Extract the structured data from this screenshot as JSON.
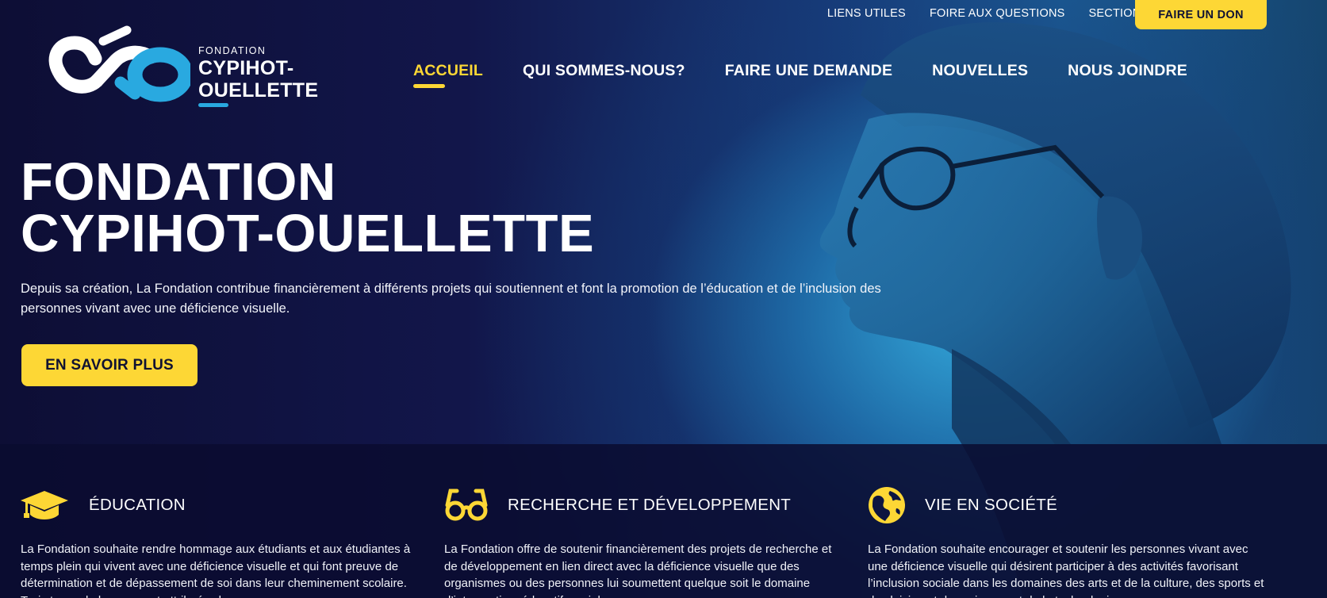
{
  "topnav": {
    "links": [
      "LIENS UTILES",
      "FOIRE AUX QUESTIONS",
      "SECTION PRIVÉE"
    ],
    "donate_label": "FAIRE UN DON"
  },
  "logo": {
    "small": "FONDATION",
    "line1": "CYPIHOT-",
    "line2": "OUELLETTE"
  },
  "mainnav": {
    "items": [
      "ACCUEIL",
      "QUI SOMMES-NOUS?",
      "FAIRE UNE DEMANDE",
      "NOUVELLES",
      "NOUS JOINDRE"
    ],
    "active": "ACCUEIL"
  },
  "hero": {
    "title_line1": "FONDATION",
    "title_line2": "CYPIHOT-OUELLETTE",
    "description": "Depuis sa création, La Fondation contribue financièrement à différents projets qui soutiennent et font la promotion de l’éducation et de l’inclusion des personnes vivant avec une déficience visuelle.",
    "cta_label": "EN SAVOIR PLUS"
  },
  "features": [
    {
      "icon": "graduation-cap-icon",
      "title": "ÉDUCATION",
      "text": "La Fondation souhaite rendre hommage aux étudiants et aux étudiantes à temps plein qui vivent avec une déficience visuelle et qui font preuve de détermination et de dépassement de soi dans leur cheminement scolaire. Trois types de bourse sont attribués chaque"
    },
    {
      "icon": "eyeglasses-icon",
      "title": "RECHERCHE ET DÉVELOPPEMENT",
      "text": "La Fondation offre de soutenir financièrement des projets de recherche et de développement en lien direct avec la déficience visuelle que des organismes ou des personnes lui soumettent quelque soit le domaine d’intervention: éducatif, social,"
    },
    {
      "icon": "globe-icon",
      "title": "VIE EN SOCIÉTÉ",
      "text": "La Fondation souhaite encourager et soutenir les personnes vivant avec une déficience visuelle qui désirent participer à des activités favorisant l’inclusion sociale dans les domaines des arts et de la culture, des sports et des loisirs, et des sciences et de la technologie"
    }
  ],
  "colors": {
    "accent_yellow": "#fdd735",
    "logo_blue": "#29a9e0",
    "panel_navy": "#0a0c30"
  }
}
